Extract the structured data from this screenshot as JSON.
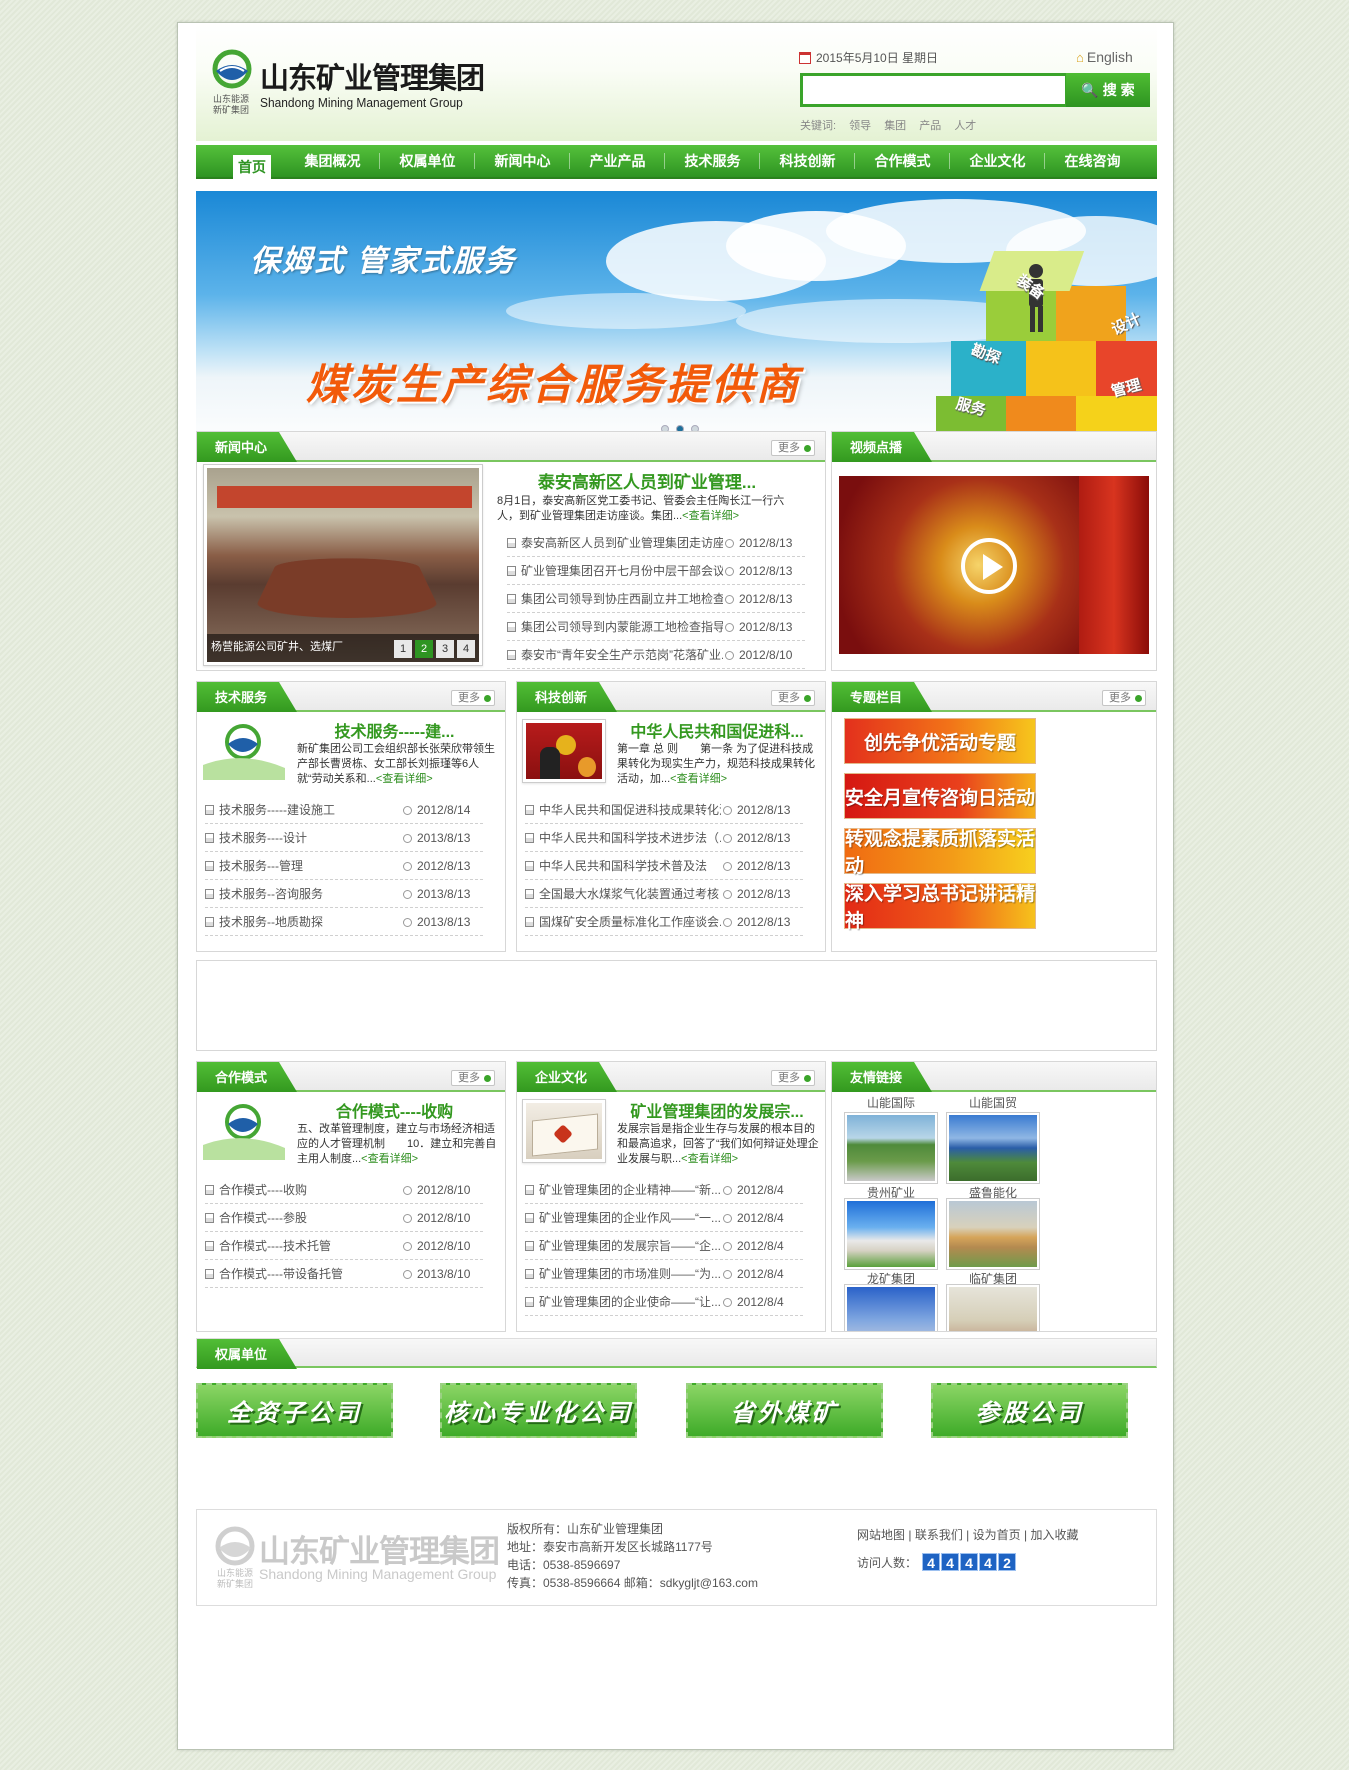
{
  "header": {
    "logo_cn": "山东矿业管理集团",
    "logo_en": "Shandong Mining Management Group",
    "logo_sub": "山东能源 新矿集团",
    "date": "2015年5月10日 星期日",
    "english": "English",
    "search_placeholder": "",
    "search_label": "搜 索",
    "keywords_label": "关键词:",
    "keywords": [
      "领导",
      "集团",
      "产品",
      "人才"
    ]
  },
  "nav": [
    "首页",
    "集团概况",
    "权属单位",
    "新闻中心",
    "产业产品",
    "技术服务",
    "科技创新",
    "合作模式",
    "企业文化",
    "在线咨询"
  ],
  "banner": {
    "tagline": "保姆式 管家式服务",
    "title": "煤炭生产综合服务提供商",
    "cubes": [
      "装备",
      "设计",
      "勘探",
      "管理",
      "服务"
    ],
    "dots": 3,
    "active_dot": 1
  },
  "news": {
    "title": "新闻中心",
    "more": "更多",
    "photo_caption": "杨营能源公司矿井、选煤厂",
    "pager": [
      "1",
      "2",
      "3",
      "4"
    ],
    "active_page": 1,
    "feature_title": "泰安高新区人员到矿业管理...",
    "feature_text": "8月1日，泰安高新区党工委书记、管委会主任陶长江一行六人，到矿业管理集团走访座谈。集团...",
    "detail": "<查看详细>",
    "items": [
      {
        "title": "泰安高新区人员到矿业管理集团走访座谈",
        "date": "2012/8/13"
      },
      {
        "title": "矿业管理集团召开七月份中层干部会议",
        "date": "2012/8/13"
      },
      {
        "title": "集团公司领导到协庄西副立井工地检查指...",
        "date": "2012/8/13"
      },
      {
        "title": "集团公司领导到内蒙能源工地检查指导工作",
        "date": "2012/8/13"
      },
      {
        "title": "泰安市“青年安全生产示范岗”花落矿业...",
        "date": "2012/8/10"
      }
    ]
  },
  "video": {
    "title": "视频点播"
  },
  "tech": {
    "title": "技术服务",
    "more": "更多",
    "feature_title": "技术服务-----建...",
    "feature_text": "新矿集团公司工会组织部长张荣欣带领生产部长曹贤栋、女工部长刘振瑾等6人就“劳动关系和...",
    "detail": "<查看详细>",
    "items": [
      {
        "title": "技术服务-----建设施工",
        "date": "2012/8/14"
      },
      {
        "title": "技术服务----设计",
        "date": "2013/8/13"
      },
      {
        "title": "技术服务---管理",
        "date": "2012/8/13"
      },
      {
        "title": "技术服务--咨询服务",
        "date": "2013/8/13"
      },
      {
        "title": "技术服务--地质勘探",
        "date": "2013/8/13"
      }
    ]
  },
  "innov": {
    "title": "科技创新",
    "more": "更多",
    "feature_title": "中华人民共和国促进科...",
    "feature_text": "第一章 总 则　　第一条 为了促进科技成果转化为现实生产力，规范科技成果转化活动，加...",
    "detail": "<查看详细>",
    "items": [
      {
        "title": "中华人民共和国促进科技成果转化法",
        "date": "2012/8/13"
      },
      {
        "title": "中华人民共和国科学技术进步法（...",
        "date": "2012/8/13"
      },
      {
        "title": "中华人民共和国科学技术普及法",
        "date": "2012/8/13"
      },
      {
        "title": "全国最大水煤浆气化装置通过考核",
        "date": "2012/8/13"
      },
      {
        "title": "国煤矿安全质量标准化工作座谈会...",
        "date": "2012/8/13"
      }
    ]
  },
  "special": {
    "title": "专题栏目",
    "more": "更多",
    "items": [
      "创先争优活动专题",
      "安全月宣传咨询日活动",
      "转观念提素质抓落实活动",
      "深入学习总书记讲话精神"
    ]
  },
  "coop": {
    "title": "合作模式",
    "more": "更多",
    "feature_title": "合作模式----收购",
    "feature_text": "五、改革管理制度，建立与市场经济相适应的人才管理机制　　10．建立和完善自主用人制度...",
    "detail": "<查看详细>",
    "items": [
      {
        "title": "合作模式----收购",
        "date": "2012/8/10"
      },
      {
        "title": "合作模式----参股",
        "date": "2012/8/10"
      },
      {
        "title": "合作模式----技术托管",
        "date": "2012/8/10"
      },
      {
        "title": "合作模式----带设备托管",
        "date": "2013/8/10"
      }
    ]
  },
  "culture": {
    "title": "企业文化",
    "more": "更多",
    "feature_title": "矿业管理集团的发展宗...",
    "feature_text": "发展宗旨是指企业生存与发展的根本目的和最高追求，回答了“我们如何辩证处理企业发展与职...",
    "detail": "<查看详细>",
    "items": [
      {
        "title": "矿业管理集团的企业精神——“新...",
        "date": "2012/8/4"
      },
      {
        "title": "矿业管理集团的企业作风——“一...",
        "date": "2012/8/4"
      },
      {
        "title": "矿业管理集团的发展宗旨——“企...",
        "date": "2012/8/4"
      },
      {
        "title": "矿业管理集团的市场准则——“为...",
        "date": "2012/8/4"
      },
      {
        "title": "矿业管理集团的企业使命——“让...",
        "date": "2012/8/4"
      }
    ]
  },
  "links": {
    "title": "友情链接",
    "top_labels": [
      "山能国际",
      "山能国贸"
    ],
    "items": [
      "贵州矿业",
      "盛鲁能化",
      "龙矿集团",
      "临矿集团"
    ]
  },
  "units": {
    "title": "权属单位",
    "items": [
      "全资子公司",
      "核心专业化公司",
      "省外煤矿",
      "参股公司"
    ]
  },
  "footer": {
    "logo_cn": "山东矿业管理集团",
    "logo_en": "Shandong Mining Management Group",
    "logo_sub": "山东能源 新矿集团",
    "copyright": "版权所有：山东矿业管理集团",
    "address": "地址：泰安市高新开发区长城路1177号",
    "phone": "电话：0538-8596697",
    "fax": "传真：0538-8596664 邮箱：sdkygljt@163.com",
    "links": [
      "网站地图",
      "联系我们",
      "设为首页",
      "加入收藏"
    ],
    "visits_label": "访问人数：",
    "visits": "44442"
  },
  "colors": {
    "brand_green": "#33991f",
    "accent_orange": "#f25a0a",
    "counter_blue": "#1e63c3"
  }
}
